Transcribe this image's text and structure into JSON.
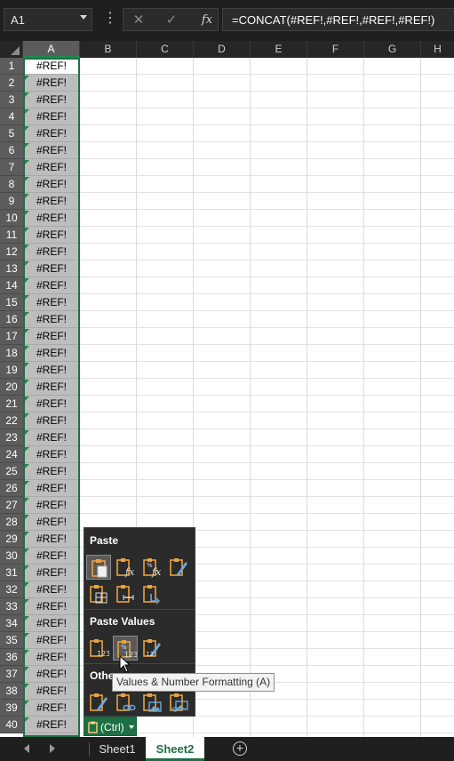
{
  "formula_bar": {
    "name_box": "A1",
    "more_icon": "vertical-ellipsis",
    "cancel_icon": "✕",
    "enter_icon": "✓",
    "fx_label": "fx",
    "formula": "=CONCAT(#REF!,#REF!,#REF!,#REF!)"
  },
  "columns": [
    "A",
    "B",
    "C",
    "D",
    "E",
    "F",
    "G",
    "H"
  ],
  "selected_column": "A",
  "rows": [
    "1",
    "2",
    "3",
    "4",
    "5",
    "6",
    "7",
    "8",
    "9",
    "10",
    "11",
    "12",
    "13",
    "14",
    "15",
    "16",
    "17",
    "18",
    "19",
    "20",
    "21",
    "22",
    "23",
    "24",
    "25",
    "26",
    "27",
    "28",
    "29",
    "30",
    "31",
    "32",
    "33",
    "34",
    "35",
    "36",
    "37",
    "38",
    "39",
    "40"
  ],
  "cell_value": "#REF!",
  "paste_menu": {
    "paste_title": "Paste",
    "paste_values_title": "Paste Values",
    "other_title": "Other",
    "paste_icons": [
      "paste-icon",
      "paste-formulas-icon",
      "paste-formulas-number-formatting-icon",
      "keep-source-formatting-icon",
      "no-borders-icon",
      "keep-column-widths-icon",
      "transpose-icon"
    ],
    "values_icons": [
      "values-icon",
      "values-number-formatting-icon",
      "values-source-formatting-icon"
    ],
    "other_icons": [
      "formatting-icon",
      "paste-link-icon",
      "picture-icon",
      "linked-picture-icon"
    ],
    "tooltip": "Values & Number Formatting (A)"
  },
  "ctrl_button": "(Ctrl)",
  "sheets": {
    "tabs": [
      "Sheet1",
      "Sheet2"
    ],
    "active": "Sheet2",
    "add_icon": "+"
  },
  "colors": {
    "accent": "#1d7044",
    "error_indicator": "#1d8a4a",
    "header_bg": "#262626",
    "selected_header_bg": "#5c5c5c"
  }
}
